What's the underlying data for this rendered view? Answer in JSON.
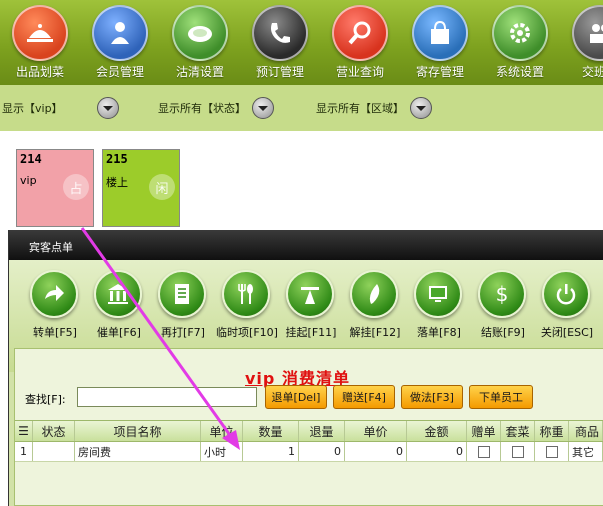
{
  "topbar": {
    "items": [
      {
        "label": "出品划菜",
        "icon": "cloche-icon",
        "color": "#d9431e"
      },
      {
        "label": "会员管理",
        "icon": "member-icon",
        "color": "#2f63b9"
      },
      {
        "label": "沽清设置",
        "icon": "plate-icon",
        "color": "#3f8e2a"
      },
      {
        "label": "预订管理",
        "icon": "phone-icon",
        "color": "#3a3a3a"
      },
      {
        "label": "营业查询",
        "icon": "magnifier-icon",
        "color": "#d8331e"
      },
      {
        "label": "寄存管理",
        "icon": "bag-icon",
        "color": "#2a6fb8"
      },
      {
        "label": "系统设置",
        "icon": "gear-icon",
        "color": "#3f8e2a"
      },
      {
        "label": "交班管",
        "icon": "people-icon",
        "color": "#4a4a4a"
      }
    ]
  },
  "filters": [
    {
      "label": "显示【vip】"
    },
    {
      "label": "显示所有【状态】"
    },
    {
      "label": "显示所有【区域】"
    }
  ],
  "rooms": [
    {
      "number": "214",
      "name": "vip",
      "mark": "占",
      "color": "#f2a1a8"
    },
    {
      "number": "215",
      "name": "楼上",
      "mark": "闲",
      "color": "#9ccc2a"
    }
  ],
  "order_window": {
    "title": "宾客点单",
    "toolbar": [
      {
        "label": "转单[F5]",
        "icon": "transfer-icon"
      },
      {
        "label": "催单[F6]",
        "icon": "bank-icon"
      },
      {
        "label": "再打[F7]",
        "icon": "document-icon"
      },
      {
        "label": "临时项[F10]",
        "icon": "utensils-icon"
      },
      {
        "label": "挂起[F11]",
        "icon": "hanger-icon"
      },
      {
        "label": "解挂[F12]",
        "icon": "feather-icon"
      },
      {
        "label": "落单[F8]",
        "icon": "screen-icon"
      },
      {
        "label": "结账[F9]",
        "icon": "dollar-icon"
      },
      {
        "label": "关闭[ESC]",
        "icon": "power-icon"
      }
    ],
    "bill_title": "vip 消费清单",
    "search_label": "查找[F]:",
    "search_value": "",
    "buttons": [
      "退单[Del]",
      "赠送[F4]",
      "做法[F3]",
      "下单员工"
    ],
    "columns": [
      "☰",
      "状态",
      "项目名称",
      "单位",
      "数量",
      "退量",
      "单价",
      "金额",
      "赠单",
      "套菜",
      "称重",
      "商品"
    ],
    "rows": [
      {
        "index": "1",
        "status": "",
        "name": "房间费",
        "unit": "小时",
        "qty": "1",
        "returned": "0",
        "price": "0",
        "amount": "0",
        "gift": false,
        "combo": false,
        "weigh": false,
        "category": "其它"
      }
    ]
  },
  "colors": {
    "accent": "#e01010",
    "toolbar_green": "#7ea21f",
    "button_orange": "#f49a00",
    "drag_arrow": "#e23be6"
  }
}
